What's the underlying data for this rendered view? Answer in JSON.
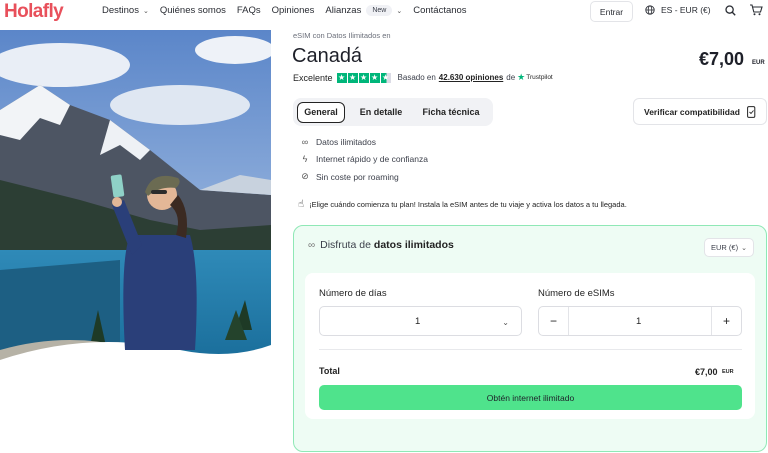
{
  "header": {
    "logo": "Holafly",
    "nav": {
      "destinos": "Destinos",
      "quienes": "Quiénes somos",
      "faqs": "FAQs",
      "opiniones": "Opiniones",
      "alianzas": "Alianzas",
      "new_badge": "New",
      "contactanos": "Contáctanos"
    },
    "login_label": "Entrar",
    "language_currency": "ES - EUR (€)"
  },
  "product": {
    "subtitle": "eSIM con Datos Ilimitados en",
    "title": "Canadá",
    "price": "€7,00",
    "price_currency": "EUR",
    "rating": {
      "label": "Excelente",
      "stars": 4.5,
      "based_on": "Basado en",
      "count": "42.630 opiniones",
      "de": "de",
      "provider": "Trustpilot"
    }
  },
  "tabs": [
    "General",
    "En detalle",
    "Ficha técnica"
  ],
  "verify_label": "Verificar compatibilidad",
  "features": [
    "Datos ilimitados",
    "Internet rápido y de confianza",
    "Sin coste por roaming"
  ],
  "notice": "¡Elige cuándo comienza tu plan! Instala la eSIM antes de tu viaje y activa los datos a tu llegada.",
  "plan": {
    "heading_prefix": "Disfruta de",
    "heading_bold": "datos ilimitados",
    "currency_select": "EUR (€)",
    "days_label": "Número de días",
    "days_value": "1",
    "esims_label": "Número de eSIMs",
    "esims_value": "1",
    "total_label": "Total",
    "total_value": "€7,00",
    "total_currency": "EUR",
    "cta": "Obtén internet ilimitado"
  },
  "colors": {
    "brand": "#e8505b",
    "accent_green": "#4fe38c",
    "trustpilot": "#00b67a",
    "plan_border": "#8fe8b6"
  },
  "icons": {
    "search": "search-icon",
    "cart": "cart-icon",
    "globe": "globe-icon",
    "infinity": "infinity-icon",
    "bolt": "bolt-icon",
    "no_roaming": "no-roaming-icon",
    "hand": "hand-icon",
    "chevron": "chevron-down-icon",
    "phone_check": "phone-check-icon"
  }
}
